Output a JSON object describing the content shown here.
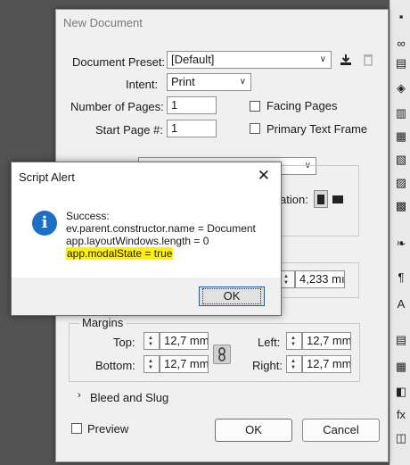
{
  "dialog": {
    "title": "New Document",
    "document_preset": {
      "label": "Document Preset:",
      "value": "[Default]"
    },
    "intent": {
      "label": "Intent:",
      "value": "Print"
    },
    "number_of_pages": {
      "label": "Number of Pages:",
      "value": "1"
    },
    "start_page": {
      "label": "Start Page #:",
      "value": "1"
    },
    "facing_pages": {
      "label": "Facing Pages",
      "checked": false
    },
    "primary_text_frame": {
      "label": "Primary Text Frame",
      "checked": false
    },
    "hidden_label_fragment": "ation:",
    "height_value": "4,233 mı",
    "margins": {
      "title": "Margins",
      "top": {
        "label": "Top:",
        "value": "12,7 mm"
      },
      "bottom": {
        "label": "Bottom:",
        "value": "12,7 mm"
      },
      "left": {
        "label": "Left:",
        "value": "12,7 mm"
      },
      "right": {
        "label": "Right:",
        "value": "12,7 mm"
      }
    },
    "bleed_and_slug": "Bleed and Slug",
    "preview": {
      "label": "Preview",
      "checked": false
    },
    "ok_label": "OK",
    "cancel_label": "Cancel"
  },
  "alert": {
    "title": "Script Alert",
    "close": "✕",
    "lines": [
      "Success:",
      "ev.parent.constructor.name = Document",
      "app.layoutWindows.length = 0",
      "app.modalState = true"
    ],
    "ok_label": "OK"
  },
  "colors": {
    "highlight": "#fff200",
    "info": "#1c6fc7",
    "ok_focus": "#0a5fc4"
  },
  "icons": [
    "save-preset-icon",
    "delete-preset-icon",
    "portrait-icon",
    "landscape-icon",
    "link-icon",
    "info-icon",
    "close-icon"
  ]
}
